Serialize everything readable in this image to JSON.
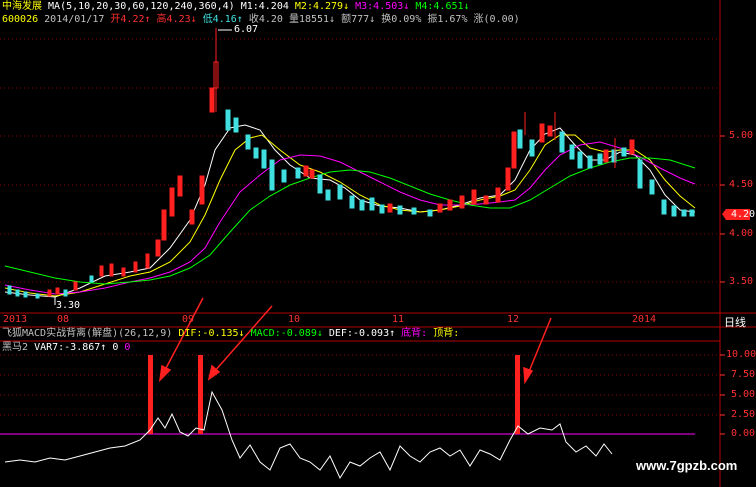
{
  "header": {
    "stock_name": "中海发展",
    "ma_params": "MA(5,10,20,30,60,120,240,360,4)",
    "m1": "M1:4.204",
    "m2": "M2:4.279↓",
    "m3": "M3:4.503↓",
    "m4": "M4:4.651↓",
    "code": "600026",
    "date": "2014/01/17",
    "open": "开4.22↑",
    "high": "高4.23↓",
    "low": "低4.16↑",
    "close": "收4.20",
    "volume": "量18551↓",
    "amount": "额777↓",
    "turnover": "换0.09%",
    "amplitude": "振1.67%",
    "change": "涨(0.00)"
  },
  "main_chart": {
    "high_label": "6.07",
    "low_label": "3.30",
    "current_price": "4.20",
    "y_ticks": [
      "5.00",
      "4.50",
      "4.00",
      "3.50"
    ],
    "x_ticks": [
      "2013",
      "08",
      "09",
      "10",
      "11",
      "12",
      "2014"
    ],
    "period": "日线",
    "colors": {
      "up": "#ff2020",
      "down": "#40e0e0",
      "ma1": "#ffffff",
      "ma2": "#ffff00",
      "ma3": "#ff00ff",
      "ma4": "#00ff00"
    }
  },
  "sub_chart": {
    "indicator_title": "飞狐MACD实战背离(解盘)(26,12,9)",
    "dif": "DIF:-0.135↓",
    "macd": "MACD:-0.089↓",
    "dea": "DEF:-0.093↑",
    "bottom_div": "底背:",
    "top_div": "顶背:",
    "second_title": "黑马2",
    "var7": "VAR7:-3.867↑",
    "var_val": "0",
    "var_val2": "0",
    "y_ticks": [
      "10.00",
      "7.50",
      "5.00",
      "2.50",
      "0.00"
    ]
  },
  "watermark": "www.7gpzb.com"
}
